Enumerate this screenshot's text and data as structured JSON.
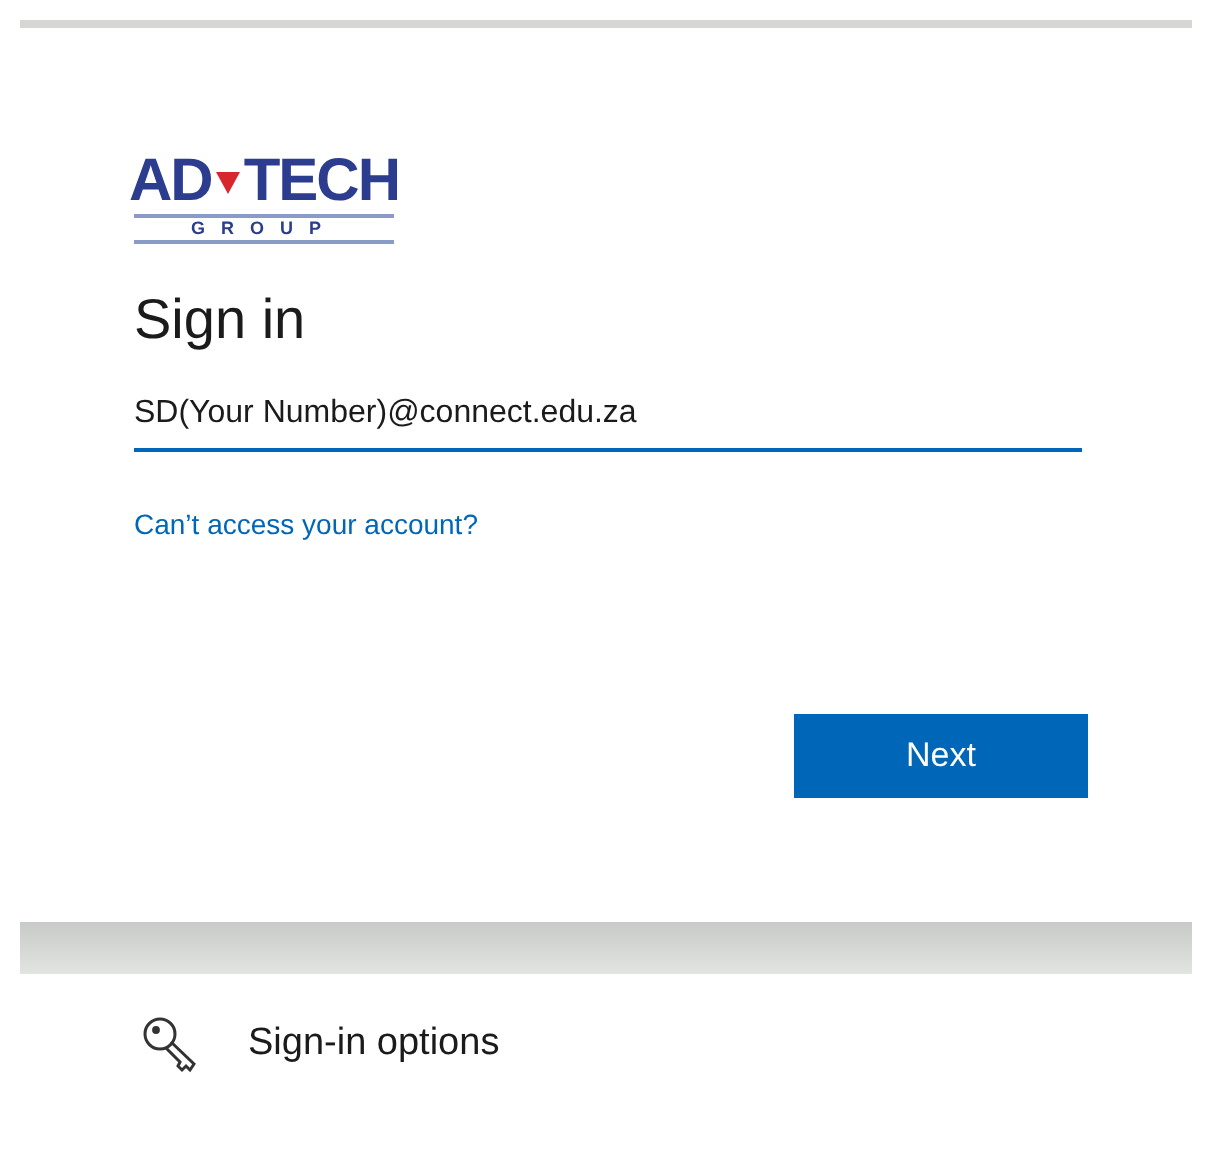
{
  "logo": {
    "word_1": "AD",
    "word_2": "TECH",
    "subtitle": "GROUP"
  },
  "title": "Sign in",
  "email_field": {
    "value": "SD(Your Number)@connect.edu.za"
  },
  "link": "Can’t access your account?",
  "next_button": "Next",
  "sign_in_options": "Sign-in options"
}
